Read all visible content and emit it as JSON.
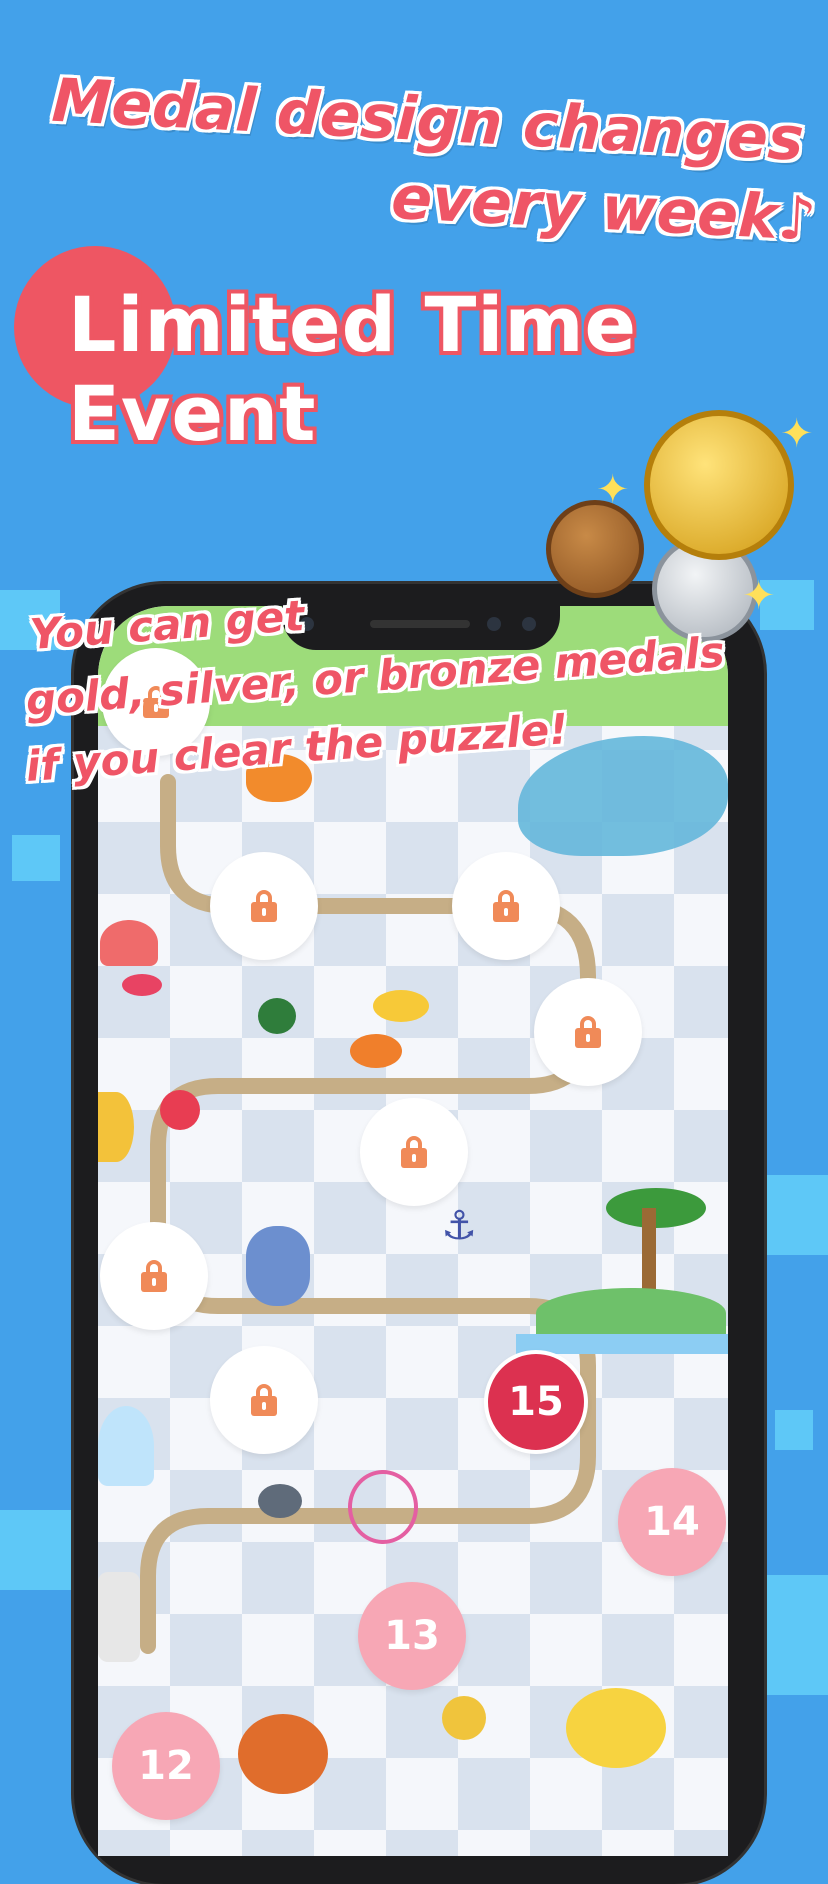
{
  "header": {
    "line1": "Medal design changes",
    "line2": "every week♪",
    "event_title": "Limited Time Event"
  },
  "caption": {
    "line1": "You can get",
    "line2": "gold, silver, or bronze medals",
    "line3": "if you clear the puzzle!"
  },
  "levels": {
    "l15": "15",
    "l14": "14",
    "l13": "13",
    "l12": "12"
  },
  "colors": {
    "background": "#43a1ea",
    "accent_red": "#ee5663",
    "current_level": "#dc3150",
    "cleared_level": "#f7a7b5",
    "path": "#c6ae86",
    "lock": "#f08a58"
  },
  "icons": [
    "lock-icon",
    "gold-medal-icon",
    "silver-medal-icon",
    "bronze-medal-icon",
    "sparkle-icon"
  ]
}
